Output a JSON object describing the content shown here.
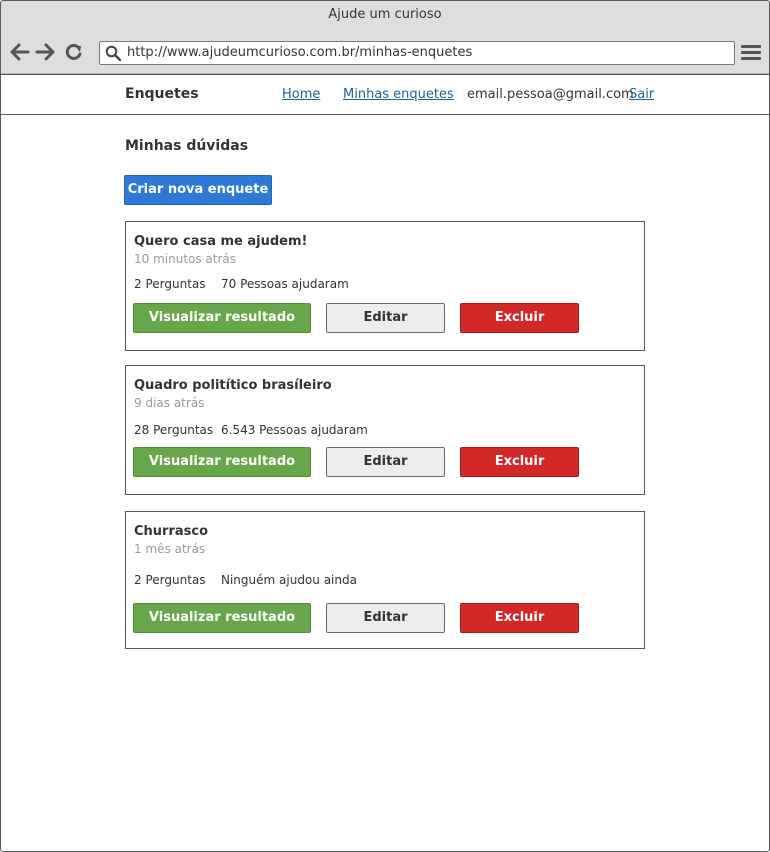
{
  "browser": {
    "window_title": "Ajude um curioso",
    "url": "http://www.ajudeumcurioso.com.br/minhas-enquetes"
  },
  "header": {
    "brand": "Enquetes",
    "nav": {
      "home": "Home",
      "mine": "Minhas enquetes"
    },
    "user_email": "email.pessoa@gmail.com",
    "logout": "Sair"
  },
  "main": {
    "title": "Minhas dúvidas",
    "create_label": "Criar nova enquete",
    "polls": [
      {
        "title": "Quero casa me ajudem!",
        "time": "10 minutos atrás",
        "questions": "2 Perguntas",
        "people": "70 Pessoas ajudaram",
        "view_label": "Visualizar resultado",
        "edit_label": "Editar",
        "delete_label": "Excluir"
      },
      {
        "title": "Quadro politítico brasíleiro",
        "time": "9 dias atrás",
        "questions": "28 Perguntas",
        "people": "6.543 Pessoas ajudaram",
        "view_label": "Visualizar resultado",
        "edit_label": "Editar",
        "delete_label": "Excluir"
      },
      {
        "title": "Churrasco",
        "time": "1 mês atrás",
        "questions": "2 Perguntas",
        "people": "Ninguém ajudou ainda",
        "view_label": "Visualizar resultado",
        "edit_label": "Editar",
        "delete_label": "Excluir"
      }
    ]
  },
  "colors": {
    "primary": "#2e79d7",
    "success": "#67a64b",
    "danger": "#d42828",
    "link": "#1f5f9b"
  },
  "icons": [
    "back-arrow-icon",
    "forward-arrow-icon",
    "reload-icon",
    "search-icon",
    "hamburger-menu-icon"
  ]
}
